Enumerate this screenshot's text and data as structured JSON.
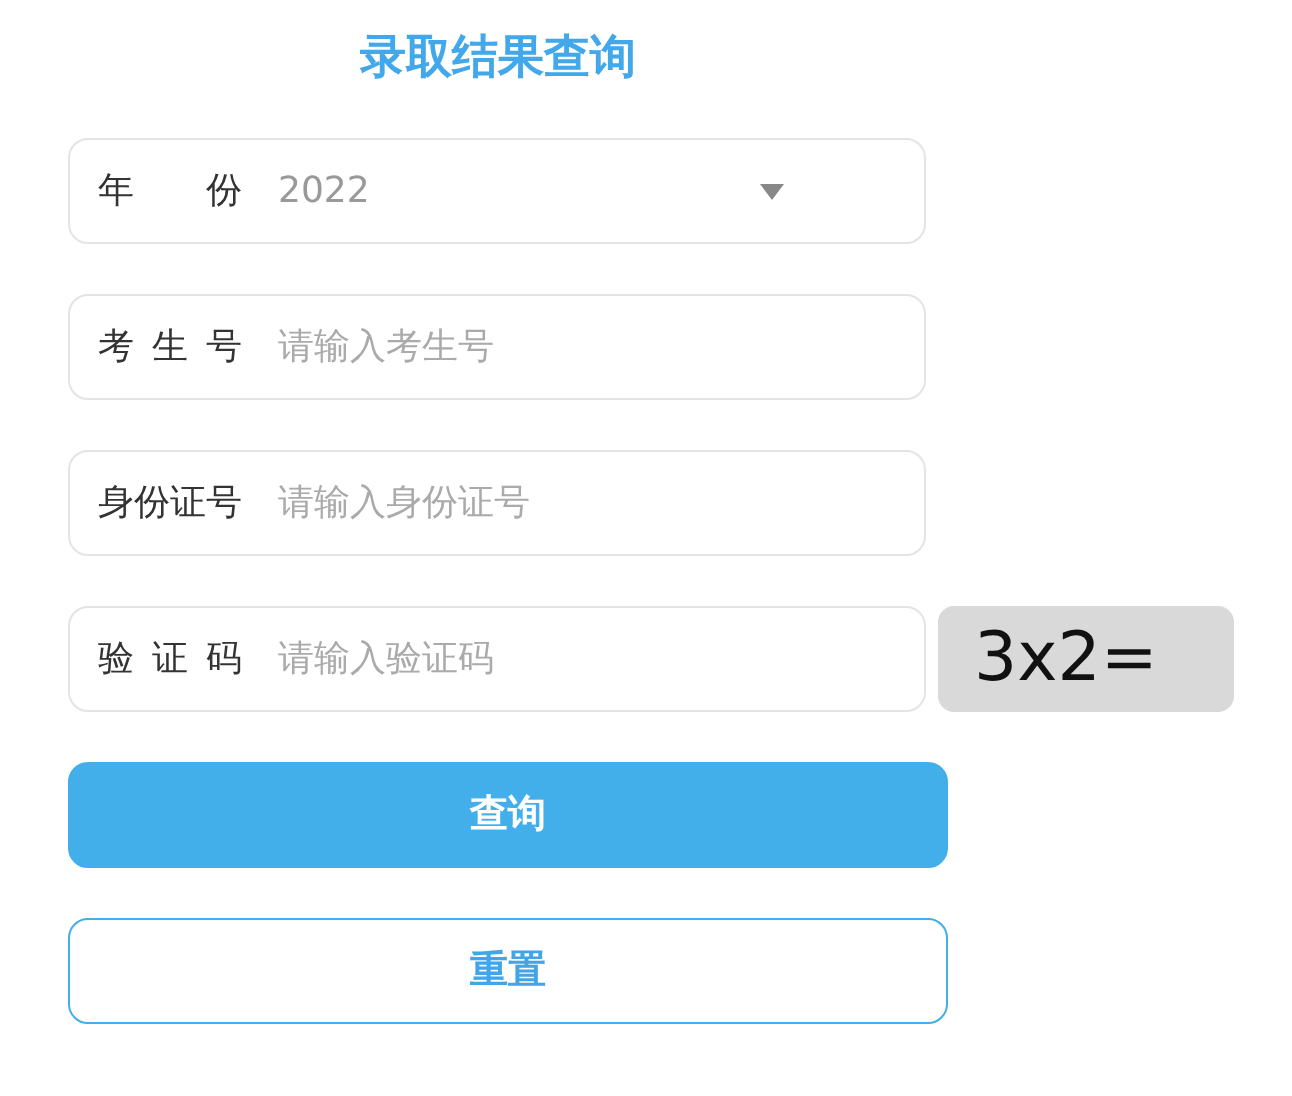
{
  "title": "录取结果查询",
  "fields": [
    {
      "kind": "select",
      "label": "年 份",
      "value": "2022"
    },
    {
      "kind": "input",
      "label": "考 生 号",
      "placeholder": "请输入考生号"
    },
    {
      "kind": "input",
      "label": "身份证号",
      "placeholder": "请输入身份证号"
    },
    {
      "kind": "captcha",
      "label": "验 证 码",
      "placeholder": "请输入验证码",
      "captcha": "3x2="
    }
  ],
  "buttons": [
    {
      "kind": "primary",
      "label": "查询"
    },
    {
      "kind": "outline",
      "label": "重置"
    }
  ]
}
